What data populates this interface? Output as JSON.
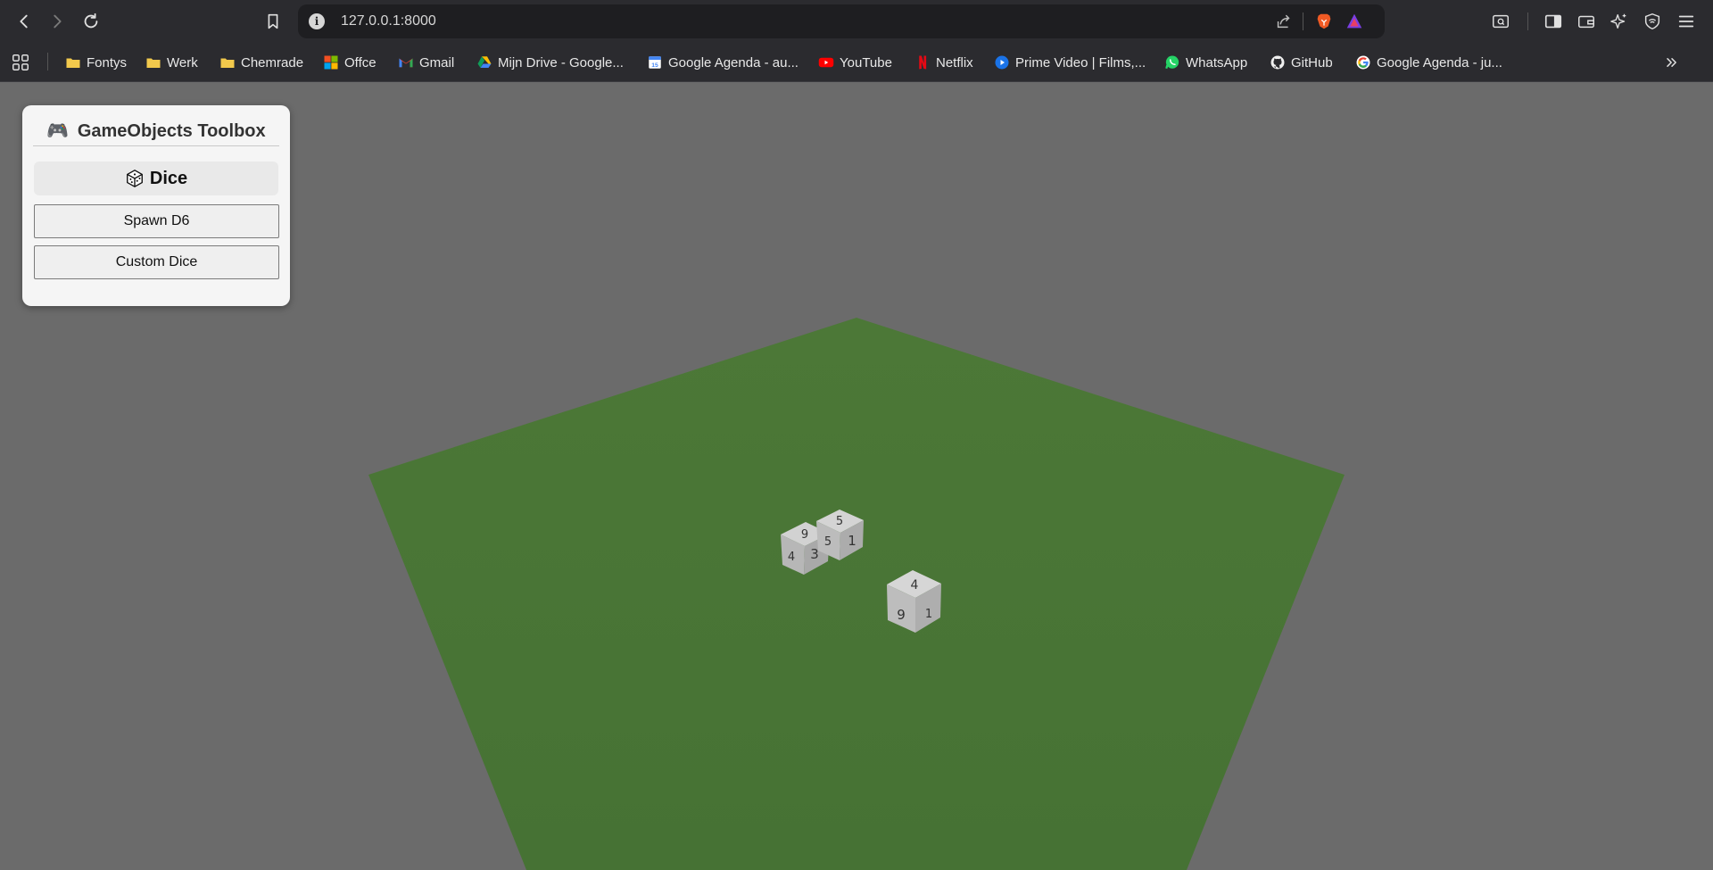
{
  "browser": {
    "url": "127.0.0.1:8000"
  },
  "bookmarks": [
    {
      "label": "Fontys",
      "icon": "folder-icon"
    },
    {
      "label": "Werk",
      "icon": "folder-icon"
    },
    {
      "label": "Chemrade",
      "icon": "folder-icon"
    },
    {
      "label": "Offce",
      "icon": "office-icon"
    },
    {
      "label": "Gmail",
      "icon": "gmail-icon"
    },
    {
      "label": "Mijn Drive - Google...",
      "icon": "drive-icon"
    },
    {
      "label": "Google Agenda - au...",
      "icon": "calendar-icon"
    },
    {
      "label": "YouTube",
      "icon": "youtube-icon"
    },
    {
      "label": "Netflix",
      "icon": "netflix-icon"
    },
    {
      "label": "Prime Video | Films,...",
      "icon": "prime-video-icon"
    },
    {
      "label": "WhatsApp",
      "icon": "whatsapp-icon"
    },
    {
      "label": "GitHub",
      "icon": "github-icon"
    },
    {
      "label": "Google Agenda - ju...",
      "icon": "google-icon"
    }
  ],
  "toolbox": {
    "title_icon": "🎮",
    "title": "GameObjects Toolbox",
    "section": "Dice",
    "spawn_label": "Spawn D6",
    "custom_label": "Custom Dice"
  },
  "scene": {
    "background_color": "#6b6b6b",
    "ground_color": "#4a7536",
    "dice": [
      {
        "top": "9",
        "left": "4",
        "right": "3"
      },
      {
        "top": "5",
        "left": "5",
        "right": "1"
      },
      {
        "top": "4",
        "left": "9",
        "right": "1"
      }
    ]
  }
}
